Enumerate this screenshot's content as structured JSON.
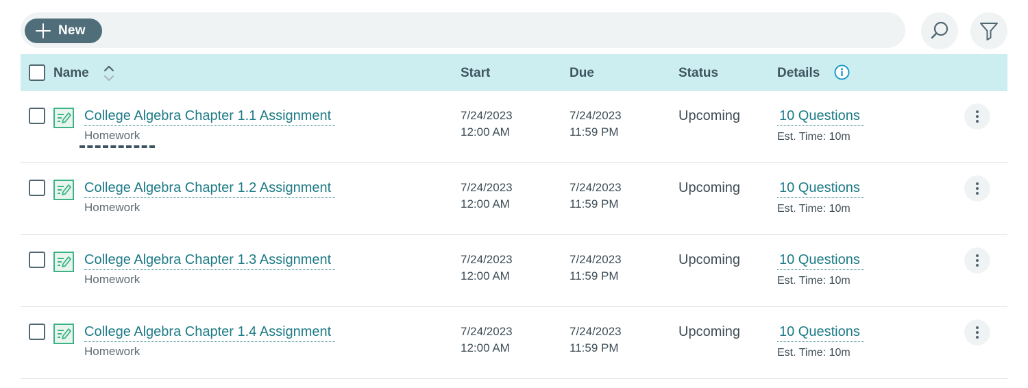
{
  "toolbar": {
    "new_label": "New"
  },
  "table": {
    "headers": {
      "name": "Name",
      "start": "Start",
      "due": "Due",
      "status": "Status",
      "details": "Details"
    },
    "rows": [
      {
        "title": "College Algebra Chapter 1.1 Assignment",
        "type": "Homework",
        "start_date": "7/24/2023",
        "start_time": "12:00 AM",
        "due_date": "7/24/2023",
        "due_time": "11:59 PM",
        "status": "Upcoming",
        "questions": "10 Questions",
        "est_time": "Est. Time: 10m"
      },
      {
        "title": "College Algebra Chapter 1.2 Assignment",
        "type": "Homework",
        "start_date": "7/24/2023",
        "start_time": "12:00 AM",
        "due_date": "7/24/2023",
        "due_time": "11:59 PM",
        "status": "Upcoming",
        "questions": "10 Questions",
        "est_time": "Est. Time: 10m"
      },
      {
        "title": "College Algebra Chapter 1.3 Assignment",
        "type": "Homework",
        "start_date": "7/24/2023",
        "start_time": "12:00 AM",
        "due_date": "7/24/2023",
        "due_time": "11:59 PM",
        "status": "Upcoming",
        "questions": "10 Questions",
        "est_time": "Est. Time: 10m"
      },
      {
        "title": "College Algebra Chapter 1.4 Assignment",
        "type": "Homework",
        "start_date": "7/24/2023",
        "start_time": "12:00 AM",
        "due_date": "7/24/2023",
        "due_time": "11:59 PM",
        "status": "Upcoming",
        "questions": "10 Questions",
        "est_time": "Est. Time: 10m"
      }
    ]
  },
  "colors": {
    "accent": "#1d7a86",
    "header_bg": "#cdeef1",
    "new_button": "#4f6e7a"
  },
  "icons": {
    "add": "plus-icon",
    "search": "search-icon",
    "filter": "filter-icon",
    "sort": "sort-icon",
    "info": "info-icon",
    "assignment": "assignment-icon",
    "more": "kebab-icon"
  }
}
